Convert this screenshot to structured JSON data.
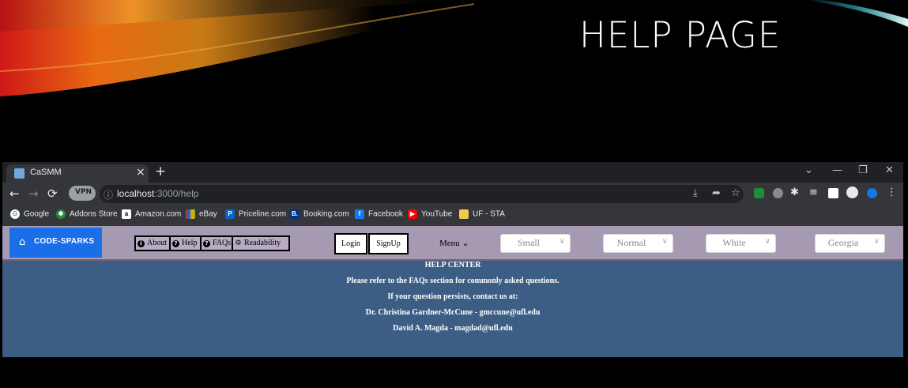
{
  "slide": {
    "title": "HELP PAGE"
  },
  "browser": {
    "tab": {
      "title": "CaSMM"
    },
    "address": {
      "vpn_label": "VPN",
      "host": "localhost",
      "path": ":3000/help"
    },
    "bookmarks": [
      {
        "label": "Google",
        "icon": "google-icon",
        "color": "#ffffff"
      },
      {
        "label": "Addons Store",
        "icon": "addons-store-icon",
        "color": "#1e8e3e"
      },
      {
        "label": "Amazon.com",
        "icon": "amazon-icon",
        "color": "#ffffff"
      },
      {
        "label": "eBay",
        "icon": "ebay-icon",
        "color": "#e53238"
      },
      {
        "label": "Priceline.com",
        "icon": "priceline-icon",
        "color": "#0a63c8"
      },
      {
        "label": "Booking.com",
        "icon": "booking-icon",
        "color": "#003580"
      },
      {
        "label": "Facebook",
        "icon": "facebook-icon",
        "color": "#1877f2"
      },
      {
        "label": "YouTube",
        "icon": "youtube-icon",
        "color": "#ff0000"
      },
      {
        "label": "UF - STA",
        "icon": "folder-icon",
        "color": "#f2c94c"
      }
    ]
  },
  "app": {
    "logo": "CODE-SPARKS",
    "nav": [
      {
        "label": "About",
        "icon": "info-icon"
      },
      {
        "label": "Help",
        "icon": "question-icon"
      },
      {
        "label": "FAQs",
        "icon": "question-icon"
      },
      {
        "label": "Readability",
        "icon": "gears-icon"
      }
    ],
    "login_label": "Login",
    "signup_label": "SignUp",
    "menu_label": "Menu",
    "selects": {
      "size": "Small",
      "weight": "Normal",
      "color": "White",
      "font": "Georgia"
    },
    "colors": {
      "appbar": "#a59ab2",
      "page": "#3c5e85",
      "logo": "#1a6ee8"
    }
  },
  "help": {
    "heading": "HELP CENTER",
    "line1": "Please refer to the FAQs section for commonly asked questions.",
    "line2": "If your question persists, contact us at:",
    "contact1": "Dr. Christina Gardner-McCune - gmccune@ufl.edu",
    "contact2": "David A. Magda - magdad@ufl.edu"
  }
}
